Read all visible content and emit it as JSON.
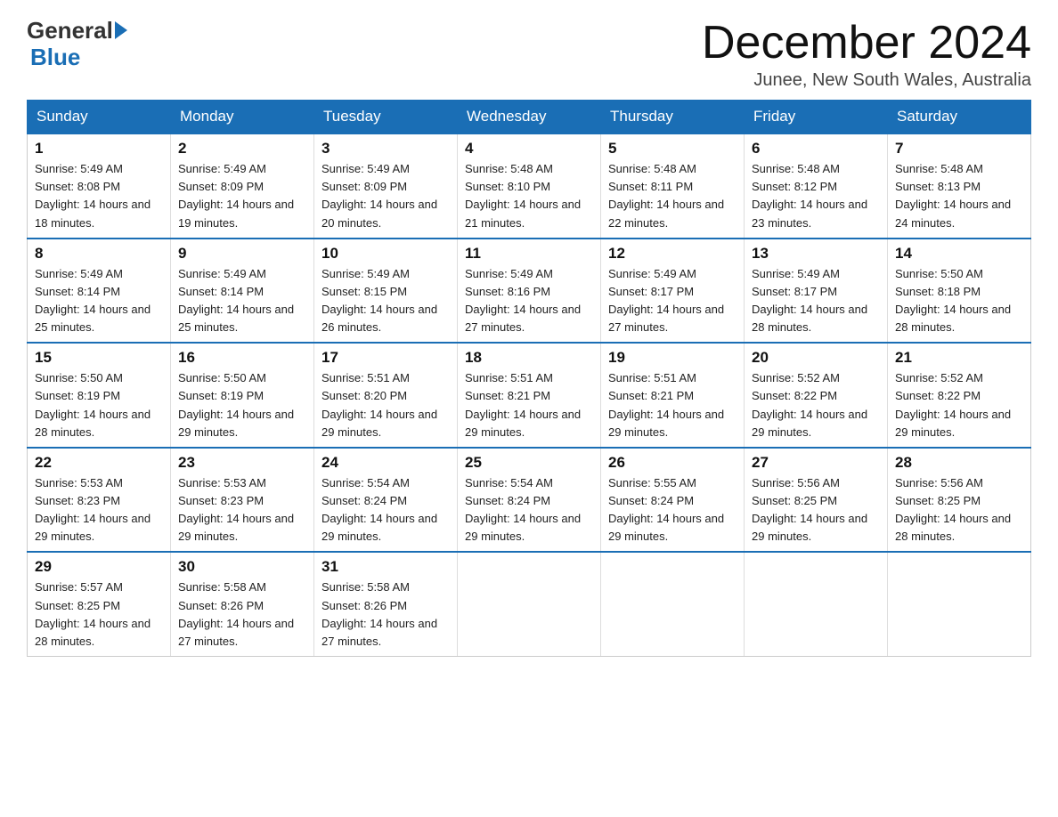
{
  "header": {
    "logo_general": "General",
    "logo_blue": "Blue",
    "month_title": "December 2024",
    "location": "Junee, New South Wales, Australia"
  },
  "days_of_week": [
    "Sunday",
    "Monday",
    "Tuesday",
    "Wednesday",
    "Thursday",
    "Friday",
    "Saturday"
  ],
  "weeks": [
    [
      {
        "day": "1",
        "sunrise": "5:49 AM",
        "sunset": "8:08 PM",
        "daylight": "14 hours and 18 minutes."
      },
      {
        "day": "2",
        "sunrise": "5:49 AM",
        "sunset": "8:09 PM",
        "daylight": "14 hours and 19 minutes."
      },
      {
        "day": "3",
        "sunrise": "5:49 AM",
        "sunset": "8:09 PM",
        "daylight": "14 hours and 20 minutes."
      },
      {
        "day": "4",
        "sunrise": "5:48 AM",
        "sunset": "8:10 PM",
        "daylight": "14 hours and 21 minutes."
      },
      {
        "day": "5",
        "sunrise": "5:48 AM",
        "sunset": "8:11 PM",
        "daylight": "14 hours and 22 minutes."
      },
      {
        "day": "6",
        "sunrise": "5:48 AM",
        "sunset": "8:12 PM",
        "daylight": "14 hours and 23 minutes."
      },
      {
        "day": "7",
        "sunrise": "5:48 AM",
        "sunset": "8:13 PM",
        "daylight": "14 hours and 24 minutes."
      }
    ],
    [
      {
        "day": "8",
        "sunrise": "5:49 AM",
        "sunset": "8:14 PM",
        "daylight": "14 hours and 25 minutes."
      },
      {
        "day": "9",
        "sunrise": "5:49 AM",
        "sunset": "8:14 PM",
        "daylight": "14 hours and 25 minutes."
      },
      {
        "day": "10",
        "sunrise": "5:49 AM",
        "sunset": "8:15 PM",
        "daylight": "14 hours and 26 minutes."
      },
      {
        "day": "11",
        "sunrise": "5:49 AM",
        "sunset": "8:16 PM",
        "daylight": "14 hours and 27 minutes."
      },
      {
        "day": "12",
        "sunrise": "5:49 AM",
        "sunset": "8:17 PM",
        "daylight": "14 hours and 27 minutes."
      },
      {
        "day": "13",
        "sunrise": "5:49 AM",
        "sunset": "8:17 PM",
        "daylight": "14 hours and 28 minutes."
      },
      {
        "day": "14",
        "sunrise": "5:50 AM",
        "sunset": "8:18 PM",
        "daylight": "14 hours and 28 minutes."
      }
    ],
    [
      {
        "day": "15",
        "sunrise": "5:50 AM",
        "sunset": "8:19 PM",
        "daylight": "14 hours and 28 minutes."
      },
      {
        "day": "16",
        "sunrise": "5:50 AM",
        "sunset": "8:19 PM",
        "daylight": "14 hours and 29 minutes."
      },
      {
        "day": "17",
        "sunrise": "5:51 AM",
        "sunset": "8:20 PM",
        "daylight": "14 hours and 29 minutes."
      },
      {
        "day": "18",
        "sunrise": "5:51 AM",
        "sunset": "8:21 PM",
        "daylight": "14 hours and 29 minutes."
      },
      {
        "day": "19",
        "sunrise": "5:51 AM",
        "sunset": "8:21 PM",
        "daylight": "14 hours and 29 minutes."
      },
      {
        "day": "20",
        "sunrise": "5:52 AM",
        "sunset": "8:22 PM",
        "daylight": "14 hours and 29 minutes."
      },
      {
        "day": "21",
        "sunrise": "5:52 AM",
        "sunset": "8:22 PM",
        "daylight": "14 hours and 29 minutes."
      }
    ],
    [
      {
        "day": "22",
        "sunrise": "5:53 AM",
        "sunset": "8:23 PM",
        "daylight": "14 hours and 29 minutes."
      },
      {
        "day": "23",
        "sunrise": "5:53 AM",
        "sunset": "8:23 PM",
        "daylight": "14 hours and 29 minutes."
      },
      {
        "day": "24",
        "sunrise": "5:54 AM",
        "sunset": "8:24 PM",
        "daylight": "14 hours and 29 minutes."
      },
      {
        "day": "25",
        "sunrise": "5:54 AM",
        "sunset": "8:24 PM",
        "daylight": "14 hours and 29 minutes."
      },
      {
        "day": "26",
        "sunrise": "5:55 AM",
        "sunset": "8:24 PM",
        "daylight": "14 hours and 29 minutes."
      },
      {
        "day": "27",
        "sunrise": "5:56 AM",
        "sunset": "8:25 PM",
        "daylight": "14 hours and 29 minutes."
      },
      {
        "day": "28",
        "sunrise": "5:56 AM",
        "sunset": "8:25 PM",
        "daylight": "14 hours and 28 minutes."
      }
    ],
    [
      {
        "day": "29",
        "sunrise": "5:57 AM",
        "sunset": "8:25 PM",
        "daylight": "14 hours and 28 minutes."
      },
      {
        "day": "30",
        "sunrise": "5:58 AM",
        "sunset": "8:26 PM",
        "daylight": "14 hours and 27 minutes."
      },
      {
        "day": "31",
        "sunrise": "5:58 AM",
        "sunset": "8:26 PM",
        "daylight": "14 hours and 27 minutes."
      },
      null,
      null,
      null,
      null
    ]
  ]
}
